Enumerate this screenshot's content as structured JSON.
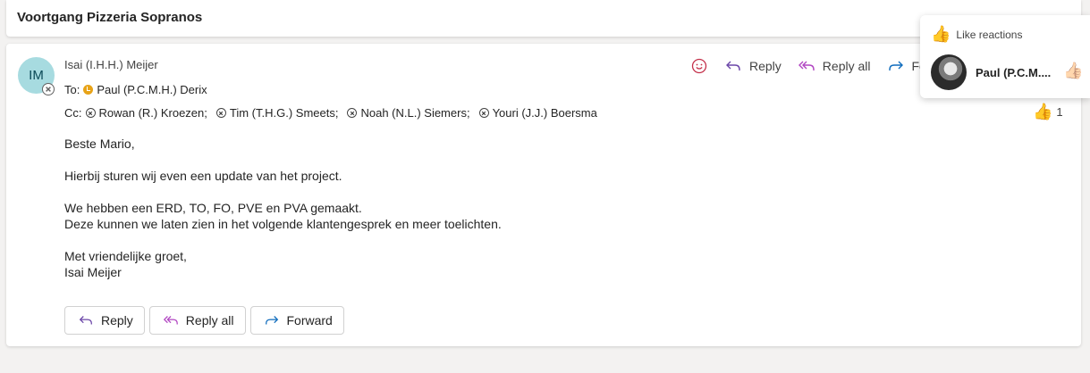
{
  "subject": "Voortgang Pizzeria Sopranos",
  "message": {
    "avatar_initials": "IM",
    "sender": "Isai (I.H.H.) Meijer",
    "to_label": "To:",
    "to": [
      "Paul (P.C.M.H.) Derix"
    ],
    "cc_label": "Cc:",
    "cc": [
      "Rowan (R.) Kroezen;",
      "Tim (T.H.G.) Smeets;",
      "Noah (N.L.) Siemers;",
      "Youri (J.J.) Boersma"
    ],
    "body": {
      "greeting": "Beste Mario,",
      "line1": "Hierbij sturen wij even een update van het project.",
      "line2": "We hebben een ERD, TO, FO, PVE en PVA gemaakt.",
      "line3": "Deze kunnen we laten zien in het volgende klantengesprek en meer toelichten.",
      "closing": "Met vriendelijke groet,",
      "signature": "Isai Meijer"
    },
    "reaction_count": "1"
  },
  "toolbar": {
    "reply": "Reply",
    "reply_all": "Reply all",
    "forward_partial": "Fo"
  },
  "actions": {
    "reply": "Reply",
    "reply_all": "Reply all",
    "forward": "Forward"
  },
  "reactions_popup": {
    "title": "Like reactions",
    "person": "Paul (P.C.M...."
  },
  "colors": {
    "avatar_bg": "#a7dbe0",
    "reply_icon": "#6b46a8",
    "reply_all_icon": "#b146c2",
    "forward_icon": "#0f6cbd",
    "away": "#e8a317"
  }
}
